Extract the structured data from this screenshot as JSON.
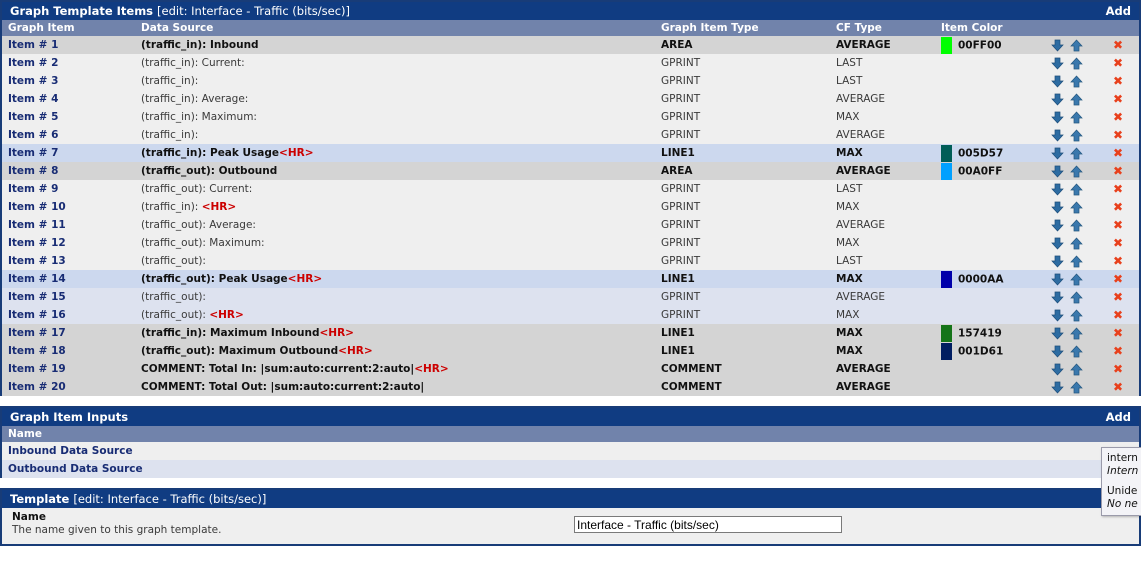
{
  "colors": {
    "title_bar": "#103c82",
    "column_header": "#7183ab",
    "row_light": "#efefef",
    "row_dark": "#d4d4d4",
    "row_sel_light": "#dde2ef",
    "row_sel_dark": "#ccd8ee",
    "link": "#182c74",
    "hr_tag": "#cc0000",
    "delete": "#e8401c",
    "arrow": "#2d6ca2"
  },
  "items_panel": {
    "title": "Graph Template Items",
    "subtitle": "[edit: Interface - Traffic (bits/sec)]",
    "add_label": "Add",
    "columns": [
      "Graph Item",
      "Data Source",
      "Graph Item Type",
      "CF Type",
      "Item Color",
      "",
      ""
    ],
    "rows": [
      {
        "item": "Item # 1",
        "source": "(traffic_in): Inbound",
        "hr": false,
        "type": "AREA",
        "cf": "AVERAGE",
        "color": "00FF00",
        "swatch": "#00FF00",
        "bold": true,
        "stripe": "dark"
      },
      {
        "item": "Item # 2",
        "source": "(traffic_in): Current:",
        "hr": false,
        "type": "GPRINT",
        "cf": "LAST",
        "color": "",
        "swatch": "",
        "bold": false,
        "stripe": "light"
      },
      {
        "item": "Item # 3",
        "source": "(traffic_in):",
        "hr": false,
        "type": "GPRINT",
        "cf": "LAST",
        "color": "",
        "swatch": "",
        "bold": false,
        "stripe": "light"
      },
      {
        "item": "Item # 4",
        "source": "(traffic_in): Average:",
        "hr": false,
        "type": "GPRINT",
        "cf": "AVERAGE",
        "color": "",
        "swatch": "",
        "bold": false,
        "stripe": "light"
      },
      {
        "item": "Item # 5",
        "source": "(traffic_in): Maximum:",
        "hr": false,
        "type": "GPRINT",
        "cf": "MAX",
        "color": "",
        "swatch": "",
        "bold": false,
        "stripe": "light"
      },
      {
        "item": "Item # 6",
        "source": "(traffic_in):",
        "hr": false,
        "type": "GPRINT",
        "cf": "AVERAGE",
        "color": "",
        "swatch": "",
        "bold": false,
        "stripe": "light"
      },
      {
        "item": "Item # 7",
        "source": "(traffic_in): Peak Usage",
        "hr": true,
        "type": "LINE1",
        "cf": "MAX",
        "color": "005D57",
        "swatch": "#005D57",
        "bold": true,
        "stripe": "sel-dark"
      },
      {
        "item": "Item # 8",
        "source": "(traffic_out): Outbound",
        "hr": false,
        "type": "AREA",
        "cf": "AVERAGE",
        "color": "00A0FF",
        "swatch": "#00A0FF",
        "bold": true,
        "stripe": "dark"
      },
      {
        "item": "Item # 9",
        "source": "(traffic_out): Current:",
        "hr": false,
        "type": "GPRINT",
        "cf": "LAST",
        "color": "",
        "swatch": "",
        "bold": false,
        "stripe": "light"
      },
      {
        "item": "Item # 10",
        "source": "(traffic_in): ",
        "hr": true,
        "type": "GPRINT",
        "cf": "MAX",
        "color": "",
        "swatch": "",
        "bold": false,
        "stripe": "light"
      },
      {
        "item": "Item # 11",
        "source": "(traffic_out): Average:",
        "hr": false,
        "type": "GPRINT",
        "cf": "AVERAGE",
        "color": "",
        "swatch": "",
        "bold": false,
        "stripe": "light"
      },
      {
        "item": "Item # 12",
        "source": "(traffic_out): Maximum:",
        "hr": false,
        "type": "GPRINT",
        "cf": "MAX",
        "color": "",
        "swatch": "",
        "bold": false,
        "stripe": "light"
      },
      {
        "item": "Item # 13",
        "source": "(traffic_out):",
        "hr": false,
        "type": "GPRINT",
        "cf": "LAST",
        "color": "",
        "swatch": "",
        "bold": false,
        "stripe": "light"
      },
      {
        "item": "Item # 14",
        "source": "(traffic_out): Peak Usage",
        "hr": true,
        "type": "LINE1",
        "cf": "MAX",
        "color": "0000AA",
        "swatch": "#0000AA",
        "bold": true,
        "stripe": "sel-dark"
      },
      {
        "item": "Item # 15",
        "source": "(traffic_out):",
        "hr": false,
        "type": "GPRINT",
        "cf": "AVERAGE",
        "color": "",
        "swatch": "",
        "bold": false,
        "stripe": "sel-light"
      },
      {
        "item": "Item # 16",
        "source": "(traffic_out): ",
        "hr": true,
        "type": "GPRINT",
        "cf": "MAX",
        "color": "",
        "swatch": "",
        "bold": false,
        "stripe": "sel-light"
      },
      {
        "item": "Item # 17",
        "source": "(traffic_in): Maximum Inbound",
        "hr": true,
        "type": "LINE1",
        "cf": "MAX",
        "color": "157419",
        "swatch": "#157419",
        "bold": true,
        "stripe": "dark"
      },
      {
        "item": "Item # 18",
        "source": "(traffic_out): Maximum Outbound",
        "hr": true,
        "type": "LINE1",
        "cf": "MAX",
        "color": "001D61",
        "swatch": "#001D61",
        "bold": true,
        "stripe": "dark"
      },
      {
        "item": "Item # 19",
        "source": "COMMENT: Total In: |sum:auto:current:2:auto|",
        "hr": true,
        "type": "COMMENT",
        "cf": "AVERAGE",
        "color": "",
        "swatch": "",
        "bold": true,
        "stripe": "dark"
      },
      {
        "item": "Item # 20",
        "source": "COMMENT: Total Out: |sum:auto:current:2:auto|",
        "hr": false,
        "type": "COMMENT",
        "cf": "AVERAGE",
        "color": "",
        "swatch": "",
        "bold": true,
        "stripe": "dark"
      }
    ],
    "hr_label": "<HR>",
    "move_down_title": "Move Down",
    "move_up_title": "Move Up",
    "delete_label": "✖"
  },
  "inputs_panel": {
    "title": "Graph Item Inputs",
    "add_label": "Add",
    "columns": [
      "Name"
    ],
    "rows": [
      {
        "name": "Inbound Data Source"
      },
      {
        "name": "Outbound Data Source"
      }
    ]
  },
  "template_panel": {
    "title": "Template",
    "subtitle": "[edit: Interface - Traffic (bits/sec)]",
    "field_label": "Name",
    "field_desc": "The name given to this graph template.",
    "field_value": "Interface - Traffic (bits/sec)",
    "field_placeholder": ""
  },
  "tooltip": {
    "line1": "intern",
    "line2": "Intern",
    "line3": "Unide",
    "line4": "No ne"
  }
}
